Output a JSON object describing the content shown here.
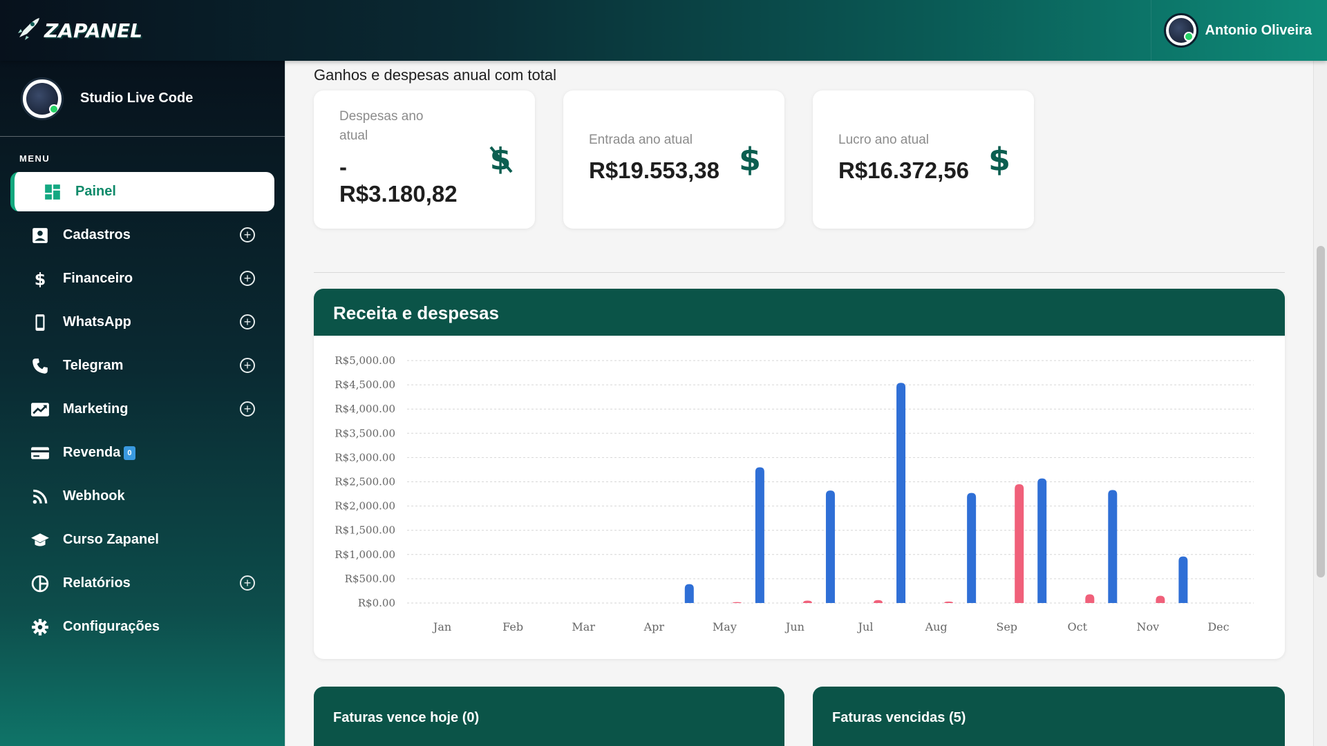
{
  "app": {
    "logo_text": "ZAPANEL",
    "user_name": "Antonio Oliveira"
  },
  "sidebar": {
    "profile_name": "Studio Live Code",
    "menu_label": "MENU",
    "items": [
      {
        "label": "Painel",
        "icon": "dashboard-icon",
        "expandable": false,
        "active": true
      },
      {
        "label": "Cadastros",
        "icon": "contact-card-icon",
        "expandable": true
      },
      {
        "label": "Financeiro",
        "icon": "dollar-icon",
        "expandable": true
      },
      {
        "label": "WhatsApp",
        "icon": "phone-device-icon",
        "expandable": true
      },
      {
        "label": "Telegram",
        "icon": "phone-handset-icon",
        "expandable": true
      },
      {
        "label": "Marketing",
        "icon": "trending-icon",
        "expandable": true
      },
      {
        "label": "Revenda",
        "icon": "credit-card-icon",
        "expandable": false,
        "badge": "0"
      },
      {
        "label": "Webhook",
        "icon": "rss-icon",
        "expandable": false
      },
      {
        "label": "Curso Zapanel",
        "icon": "graduation-cap-icon",
        "expandable": false
      },
      {
        "label": "Relatórios",
        "icon": "pie-chart-icon",
        "expandable": true
      },
      {
        "label": "Configurações",
        "icon": "gear-icon",
        "expandable": false
      }
    ]
  },
  "main": {
    "section_title": "Ganhos e despesas anual com total",
    "cards": [
      {
        "label_line1": "Despesas ano",
        "label_line2": "atual",
        "value_line1": "-",
        "value_line2": "R$3.180,82",
        "icon": "dollar-off-icon"
      },
      {
        "label": "Entrada ano atual",
        "value": "R$19.553,38",
        "icon": "dollar-icon"
      },
      {
        "label": "Lucro ano atual",
        "value": "R$16.372,56",
        "icon": "dollar-icon"
      }
    ],
    "chart_title": "Receita e despesas",
    "invoice_today": "Faturas vence hoje (0)",
    "invoice_overdue": "Faturas vencidas (5)"
  },
  "colors": {
    "accent": "#0b5448",
    "income": "#2f6fd6",
    "expense": "#f0607a"
  },
  "chart_data": {
    "type": "bar",
    "categories": [
      "Jan",
      "Feb",
      "Mar",
      "Apr",
      "May",
      "Jun",
      "Jul",
      "Aug",
      "Sep",
      "Oct",
      "Nov",
      "Dec"
    ],
    "series": [
      {
        "values": [
          0,
          0,
          0,
          0,
          20,
          50,
          60,
          30,
          2450,
          180,
          150,
          0
        ]
      },
      {
        "values": [
          0,
          0,
          0,
          390,
          2800,
          2320,
          4540,
          2270,
          2570,
          2330,
          960,
          0
        ]
      }
    ],
    "y_ticks": [
      "R$0.00",
      "R$500.00",
      "R$1,000.00",
      "R$1,500.00",
      "R$2,000.00",
      "R$2,500.00",
      "R$3,000.00",
      "R$3,500.00",
      "R$4,000.00",
      "R$4,500.00",
      "R$5,000.00"
    ],
    "ylim": [
      0,
      5000
    ],
    "grid": true
  }
}
